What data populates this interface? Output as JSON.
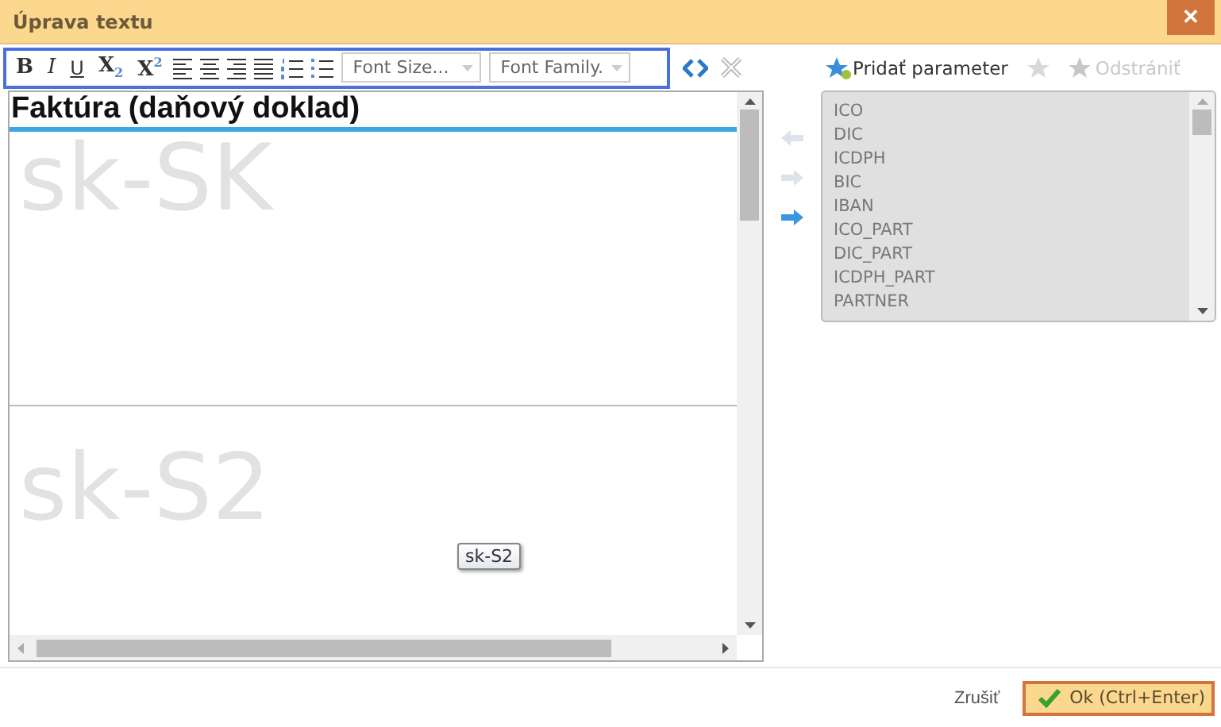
{
  "window": {
    "title": "Úprava textu",
    "close_label": "✕"
  },
  "toolbar": {
    "format_buttons": [
      "B",
      "I",
      "U",
      "X$_{2}$",
      "X$^{2}$"
    ],
    "selects": [
      {
        "placeholder": "Font Size..."
      },
      {
        "placeholder": "Font Family."
      }
    ]
  },
  "editor": {
    "heading": "Faktúra (daňový doklad)",
    "sections": [
      {
        "watermark": "sk-SK"
      },
      {
        "watermark": "sk-S2"
      }
    ],
    "tooltip": "sk-S2"
  },
  "parameters": {
    "add_button": {
      "label": "Pridať parameter",
      "disabled": false
    },
    "favorite_disabled": true,
    "remove_button": {
      "label": "Odstrániť",
      "disabled": true
    },
    "move_buttons": [
      {
        "disabled": true
      },
      {
        "disabled": true
      },
      {
        "disabled": false
      }
    ],
    "items": [
      "ICO",
      "DIC",
      "ICDPH",
      "BIC",
      "IBAN",
      "ICO_PART",
      "DIC_PART",
      "ICDPH_PART",
      "PARTNER"
    ]
  },
  "footer": {
    "cancel": "Zrušiť",
    "ok": "Ok (Ctrl+Enter)"
  }
}
